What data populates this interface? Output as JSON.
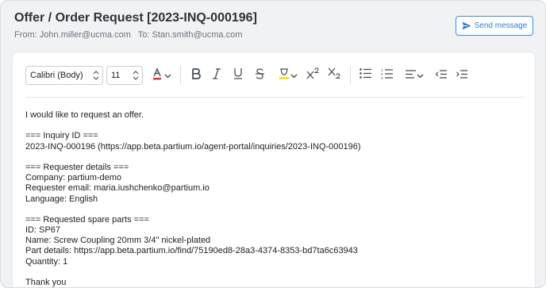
{
  "header": {
    "title": "Offer / Order Request [2023-INQ-000196]",
    "from_label": "From:",
    "from_value": "John.miller@ucma.com",
    "to_label": "To:",
    "to_value": "Stan.smith@ucma.com",
    "send_label": "Send message"
  },
  "toolbar": {
    "font_family": "Calibri (Body)",
    "font_size": "11",
    "font_color": "#d63a3a",
    "highlight_color": "#f3e12b",
    "buttons": [
      "bold",
      "italic",
      "underline",
      "strikethrough",
      "highlight",
      "superscript",
      "subscript",
      "bulleted-list",
      "numbered-list",
      "align",
      "decrease-indent",
      "increase-indent"
    ]
  },
  "message": {
    "lines": [
      "I would like to request an offer.",
      "",
      "=== Inquiry ID ===",
      "2023-INQ-000196 (https://app.beta.partium.io/agent-portal/inquiries/2023-INQ-000196)",
      "",
      "=== Requester details ===",
      "Company: partium-demo",
      "Requester email: maria.iushchenko@partium.io",
      "Language: English",
      "",
      "=== Requested spare parts ===",
      "ID: SP67",
      "Name: Screw Coupling 20mm 3/4\" nickel-plated",
      "Part details: https://app.beta.partium.io/find/75190ed8-28a3-4374-8353-bd7ta6c63943",
      "Quantity: 1",
      "",
      "Thank you"
    ]
  },
  "colors": {
    "accent": "#2f7fd3",
    "background": "#f1f2f4"
  }
}
